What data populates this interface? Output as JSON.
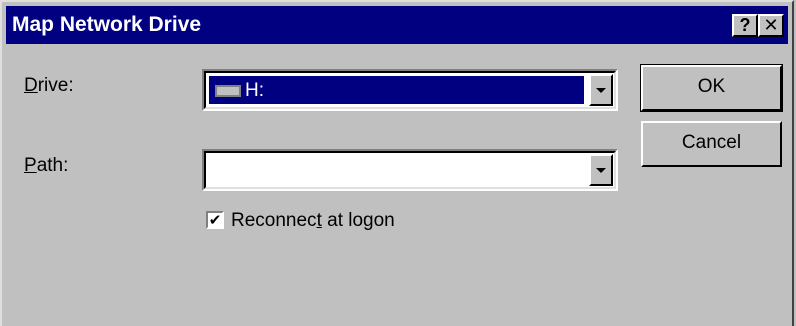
{
  "window": {
    "title": "Map Network Drive",
    "help_glyph": "?",
    "close_glyph": "✕"
  },
  "drive": {
    "label_accel": "D",
    "label_rest": "rive:",
    "value": "H:",
    "icon": "drive-icon"
  },
  "path": {
    "label_accel": "P",
    "label_rest": "ath:",
    "value": ""
  },
  "reconnect": {
    "label_pre": "Reconnec",
    "label_accel": "t",
    "label_post": " at logon",
    "checked": true,
    "check_glyph": "✔"
  },
  "buttons": {
    "ok": "OK",
    "cancel": "Cancel"
  },
  "colors": {
    "titlebar": "#000080",
    "face": "#c0c0c0",
    "selection": "#000080"
  }
}
